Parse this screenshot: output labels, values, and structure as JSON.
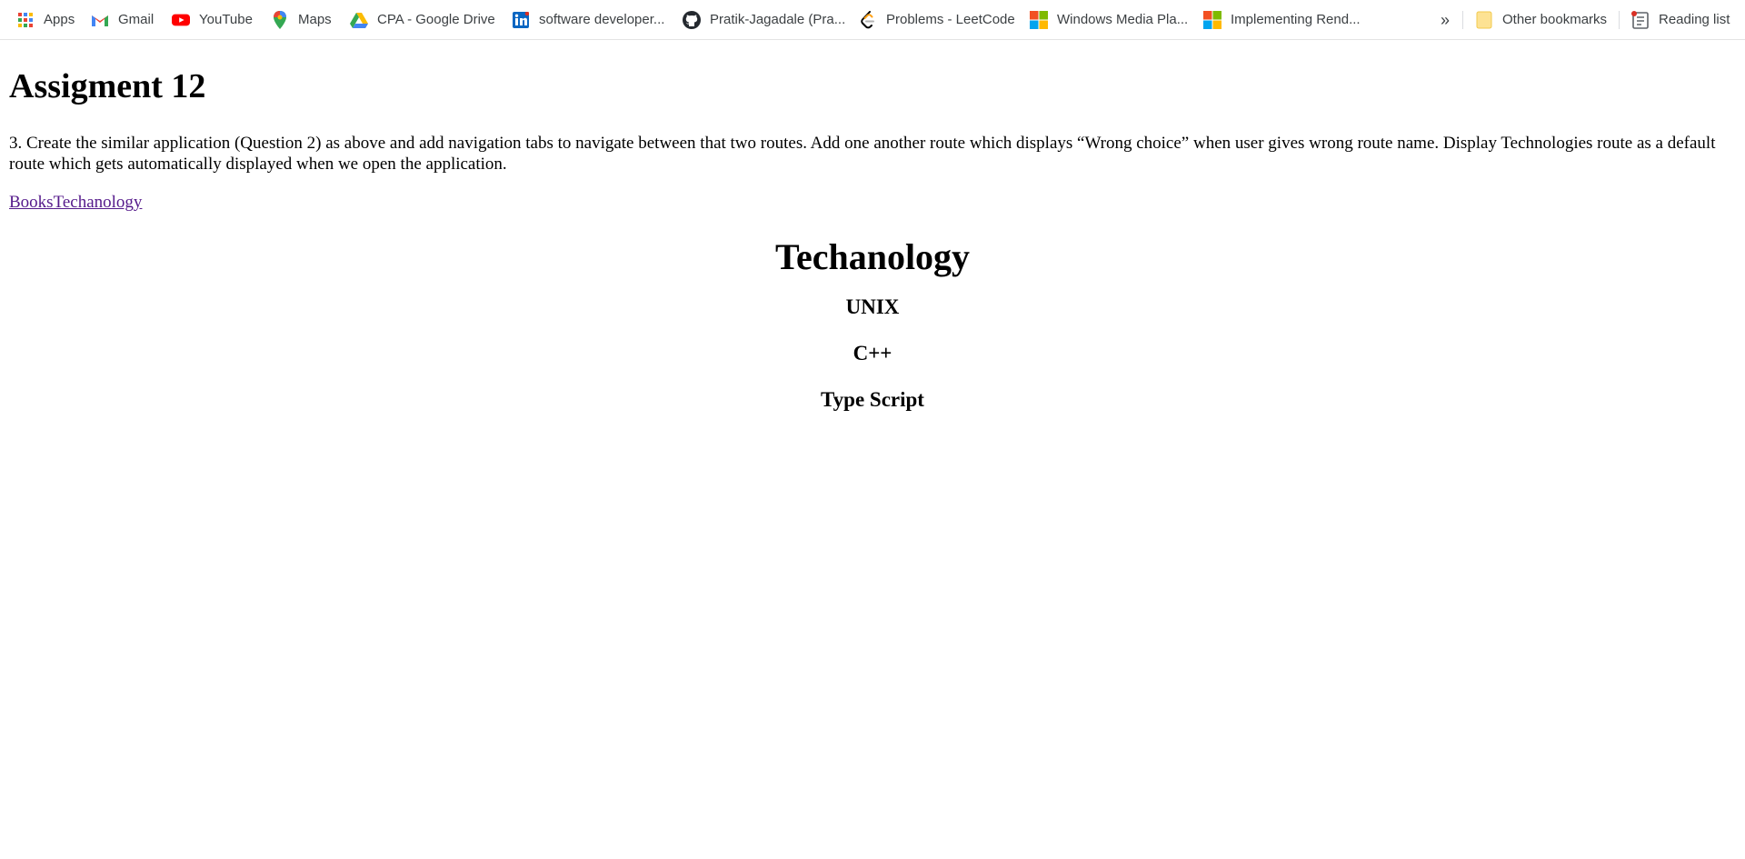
{
  "bookmarks": {
    "apps": "Apps",
    "gmail": "Gmail",
    "youtube": "YouTube",
    "maps": "Maps",
    "drive": "CPA - Google Drive",
    "linkedin": "software developer...",
    "github": "Pratik-Jagadale (Pra...",
    "leetcode": "Problems - LeetCode",
    "wmp": "Windows Media Pla...",
    "impl": "Implementing Rend...",
    "more": "»",
    "other": "Other bookmarks",
    "reading": "Reading list"
  },
  "page": {
    "title": "Assigment 12",
    "description": "3. Create the similar application (Question 2) as above and add navigation tabs to navigate between that two routes. Add one another route which displays “Wrong choice” when user gives wrong route name. Display Technologies route as a default route which gets automatically displayed when we open the application.",
    "nav": {
      "books": "Books",
      "tech": "Techanology"
    },
    "route_title": "Techanology",
    "technologies": [
      "UNIX",
      "C++",
      "Type Script"
    ]
  }
}
